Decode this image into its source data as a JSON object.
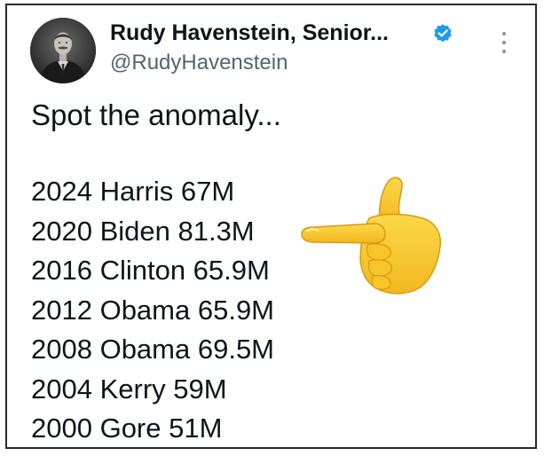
{
  "author": {
    "display_name": "Rudy Havenstein, Senior...",
    "handle": "@RudyHavenstein",
    "verified": true
  },
  "tweet": {
    "intro": "Spot the anomaly...",
    "lines": [
      "2024 Harris 67M",
      "2020 Biden 81.3M",
      "2016 Clinton 65.9M",
      "2012 Obama 65.9M",
      "2008 Obama 69.5M",
      "2004 Kerry 59M",
      "2000 Gore 51M"
    ]
  },
  "icons": {
    "verified": "verified-badge-icon",
    "more": "more-options-icon",
    "emoji": "backhand-index-pointing-left-emoji"
  },
  "colors": {
    "text_primary": "#0f1419",
    "text_secondary": "#536471",
    "verified_blue": "#1d9bf0",
    "emoji_yellow": "#f7c62f"
  }
}
